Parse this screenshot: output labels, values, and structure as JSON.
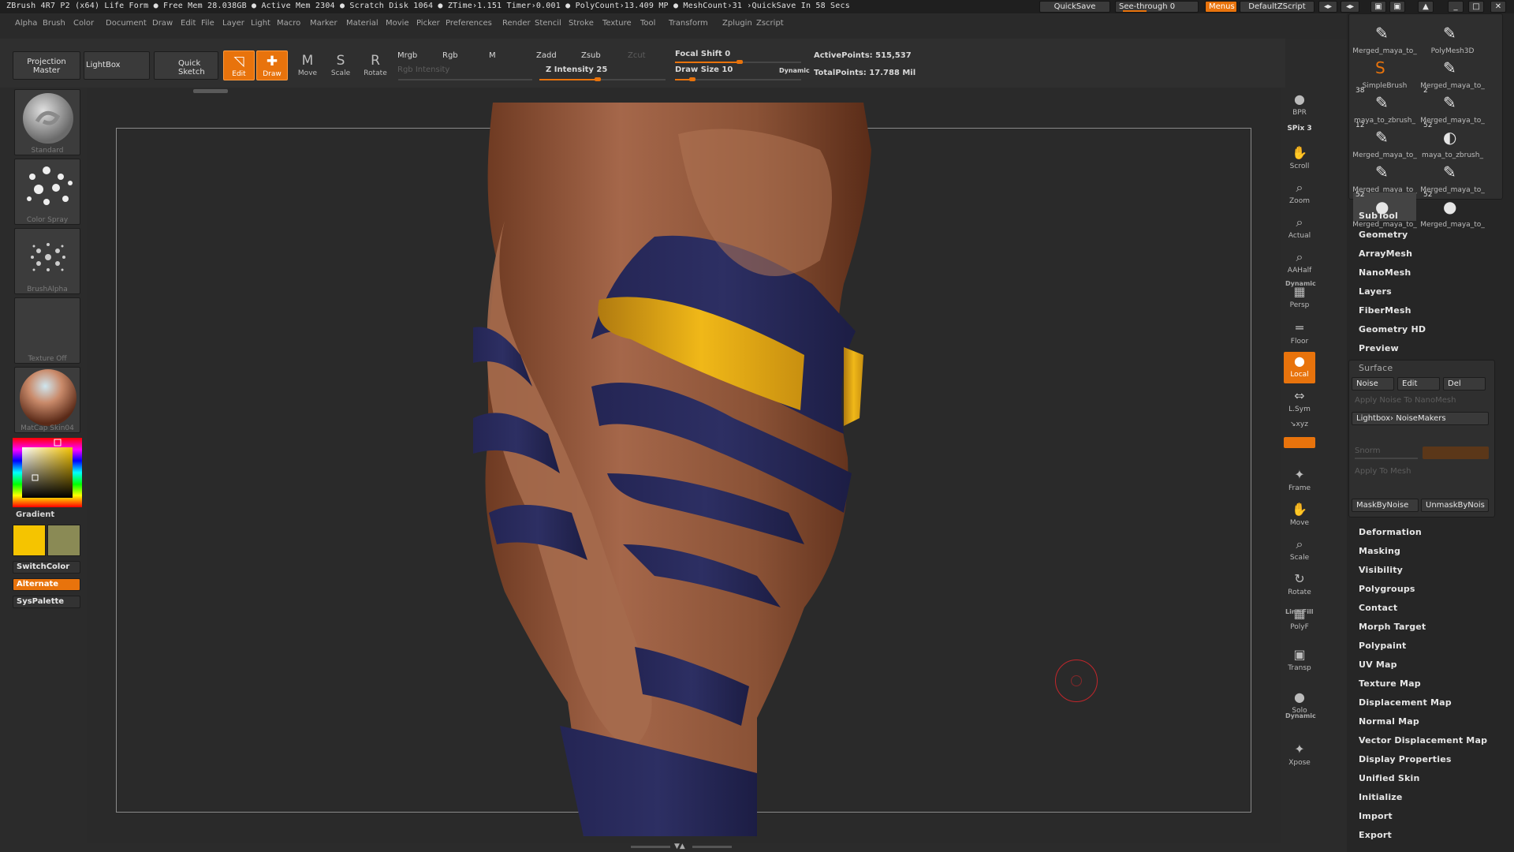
{
  "titlebar": {
    "title": "ZBrush 4R7 P2 (x64)   Life Form   ● Free Mem 28.038GB ● Active Mem 2304 ● Scratch Disk 1064 ●  ZTime›1.151 Timer›0.001 ● PolyCount›13.409 MP ● MeshCount›31   ›QuickSave In 58 Secs",
    "quicksave": "QuickSave",
    "seethrough": "See-through  0",
    "menus": "Menus",
    "script": "DefaultZScript"
  },
  "menubar": [
    "Alpha",
    "Brush",
    "Color",
    "Document",
    "Draw",
    "Edit",
    "File",
    "Layer",
    "Light",
    "Macro",
    "Marker",
    "Material",
    "Movie",
    "Picker",
    "Preferences",
    "Render",
    "Stencil",
    "Stroke",
    "Texture",
    "Tool",
    "Transform",
    "Zplugin",
    "Zscript"
  ],
  "shelf": {
    "projection_master": "Projection Master",
    "lightbox": "LightBox",
    "quick_sketch": "Quick Sketch",
    "tools": [
      {
        "glyph": "◹",
        "label": "Edit",
        "active": true
      },
      {
        "glyph": "✚",
        "label": "Draw",
        "active": true
      },
      {
        "glyph": "M",
        "label": "Move",
        "active": false
      },
      {
        "glyph": "S",
        "label": "Scale",
        "active": false
      },
      {
        "glyph": "R",
        "label": "Rotate",
        "active": false
      }
    ],
    "mrgb": "Mrgb",
    "rgb": "Rgb",
    "m": "M",
    "rgb_intensity": "Rgb  Intensity",
    "zadd": "Zadd",
    "zsub": "Zsub",
    "zcut": "Zcut",
    "z_intensity": "Z Intensity 25",
    "focal_shift": "Focal Shift 0",
    "draw_size": "Draw Size 10",
    "dynamic": "Dynamic",
    "active_points": "ActivePoints: 515,537",
    "total_points": "TotalPoints: 17.788 Mil"
  },
  "left": {
    "thumbs": [
      "Standard",
      "Color Spray",
      "BrushAlpha",
      "Texture Off",
      "MatCap Skin04"
    ],
    "gradient": "Gradient",
    "switchcolor": "SwitchColor",
    "alternate": "Alternate",
    "syspalette": "SysPalette",
    "colors": {
      "primary": "#f5c400",
      "secondary": "#8a8a55"
    }
  },
  "rightshelf": [
    {
      "glyph": "●",
      "label": "BPR"
    },
    {
      "glyph": "",
      "label": "SPix 3"
    },
    {
      "glyph": "✋",
      "label": "Scroll"
    },
    {
      "glyph": "⌕",
      "label": "Zoom"
    },
    {
      "glyph": "⌕",
      "label": "Actual"
    },
    {
      "glyph": "⌕",
      "label": "AAHalf"
    },
    {
      "glyph": "▦",
      "label": "Persp"
    },
    {
      "glyph": "═",
      "label": "Floor"
    },
    {
      "glyph": "●",
      "label": "Local"
    },
    {
      "glyph": "⇔",
      "label": "L.Sym"
    },
    {
      "glyph": "✦",
      "label": "Frame"
    },
    {
      "glyph": "✋",
      "label": "Move"
    },
    {
      "glyph": "⌕",
      "label": "Scale"
    },
    {
      "glyph": "↻",
      "label": "Rotate"
    },
    {
      "glyph": "▦",
      "label": "PolyF"
    },
    {
      "glyph": "▣",
      "label": "Transp"
    },
    {
      "glyph": "●",
      "label": "Solo"
    },
    {
      "glyph": "✦",
      "label": "Xpose"
    }
  ],
  "rightshelf_extra": {
    "dynamic1": "Dynamic",
    "linefill": "Line Fill",
    "xyz": "↘xyz",
    "dynamic2": "Dynamic"
  },
  "subtools": [
    {
      "name": "Merged_maya_to_",
      "num": ""
    },
    {
      "name": "PolyMesh3D",
      "num": ""
    },
    {
      "name": "SimpleBrush",
      "num": ""
    },
    {
      "name": "Merged_maya_to_",
      "num": ""
    },
    {
      "name": "maya_to_zbrush_",
      "num": "38"
    },
    {
      "name": "Merged_maya_to_",
      "num": "2"
    },
    {
      "name": "Merged_maya_to_",
      "num": "12"
    },
    {
      "name": "maya_to_zbrush_",
      "num": "52"
    },
    {
      "name": "Merged_maya_to_",
      "num": ""
    },
    {
      "name": "Merged_maya_to_",
      "num": ""
    },
    {
      "name": "Merged_maya_to_",
      "num": "52"
    },
    {
      "name": "Merged_maya_to_",
      "num": "52"
    }
  ],
  "panel_menus_top": [
    "SubTool",
    "Geometry",
    "ArrayMesh",
    "NanoMesh",
    "Layers",
    "FiberMesh",
    "Geometry HD",
    "Preview"
  ],
  "surface": {
    "title": "Surface",
    "noise": "Noise",
    "edit": "Edit",
    "del": "Del",
    "apply_nano": "Apply Noise To NanoMesh",
    "lightbox_noise": "Lightbox› NoiseMakers",
    "snorm": "Snorm",
    "apply_mesh": "Apply To Mesh",
    "mask_by_noise": "MaskByNoise",
    "unmask_by_noise": "UnmaskByNois"
  },
  "panel_menus_bottom": [
    "Deformation",
    "Masking",
    "Visibility",
    "Polygroups",
    "Contact",
    "Morph Target",
    "Polypaint",
    "UV Map",
    "Texture Map",
    "Displacement Map",
    "Normal Map",
    "Vector Displacement Map",
    "Display Properties",
    "Unified Skin",
    "Initialize",
    "Import",
    "Export"
  ]
}
